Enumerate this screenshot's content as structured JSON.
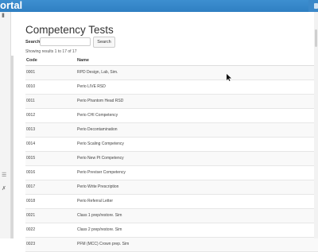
{
  "header": {
    "brand": "ortal"
  },
  "sidebar": {
    "icons": [
      "bar-chart-icon",
      "list-icon",
      "wrench-icon"
    ]
  },
  "page": {
    "title": "Competency Tests",
    "search_label": "Search",
    "search_placeholder": "",
    "search_button": "Search",
    "results_text": "Showing results 1 to 17 of 17"
  },
  "table": {
    "columns": [
      "Code",
      "Name"
    ],
    "rows": [
      {
        "code": "0001",
        "name": "RPD Design, Lab, Sim."
      },
      {
        "code": "0010",
        "name": "Perio LIVE RSD"
      },
      {
        "code": "0011",
        "name": "Perio Phantom Head RSD"
      },
      {
        "code": "0012",
        "name": "Perio CHI Competency"
      },
      {
        "code": "0013",
        "name": "Perio Decontamination"
      },
      {
        "code": "0014",
        "name": "Perio Scaling Competency"
      },
      {
        "code": "0015",
        "name": "Perio New Pt Competency"
      },
      {
        "code": "0016",
        "name": "Perio Previser Competency"
      },
      {
        "code": "0017",
        "name": "Perio Write Prescription"
      },
      {
        "code": "0018",
        "name": "Perio Referral Letter"
      },
      {
        "code": "0021",
        "name": "Class 1 prep/restore. Sim"
      },
      {
        "code": "0022",
        "name": "Class 2 prep/restore. Sim"
      },
      {
        "code": "0023",
        "name": "PFM (MCC) Crown prep. Sim"
      }
    ]
  }
}
